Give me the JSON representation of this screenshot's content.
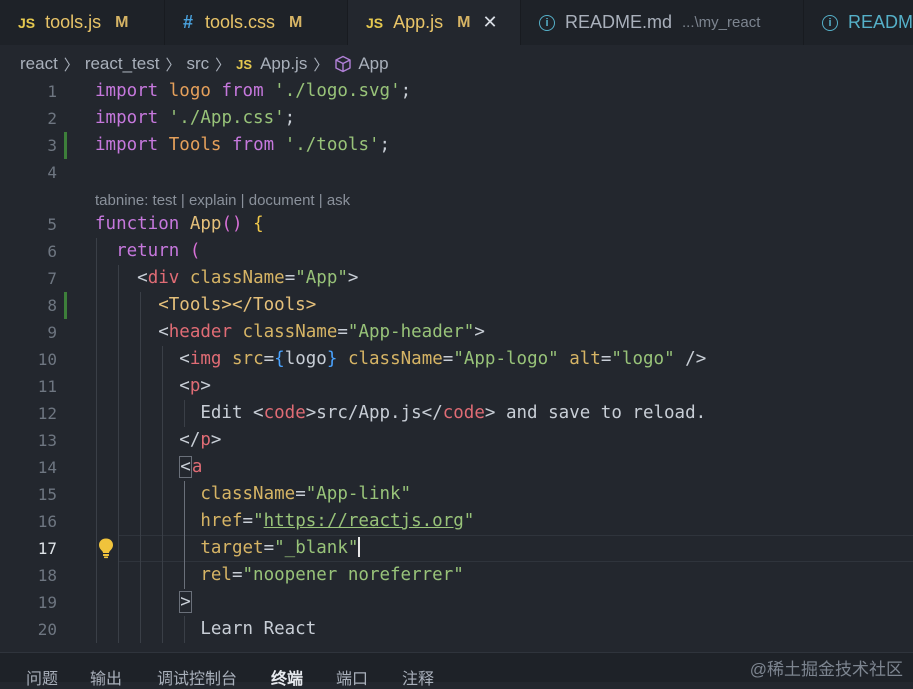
{
  "tabs": [
    {
      "label": "tools.js",
      "icon": "JS",
      "status": "M"
    },
    {
      "label": "tools.css",
      "icon": "#",
      "status": "M"
    },
    {
      "label": "App.js",
      "icon": "JS",
      "status": "M",
      "close": "✕"
    },
    {
      "label": "README.md",
      "icon": "i",
      "description": "...\\my_react"
    },
    {
      "label": "READM",
      "icon": "i"
    }
  ],
  "breadcrumb": [
    "react",
    "react_test",
    "src",
    "App.js",
    "App"
  ],
  "breadcrumb_icon_js": "JS",
  "codelens": "tabnine: test | explain | document | ask",
  "line_numbers": [
    "1",
    "2",
    "3",
    "4",
    "5",
    "6",
    "7",
    "8",
    "9",
    "10",
    "11",
    "12",
    "13",
    "14",
    "15",
    "16",
    "17",
    "18",
    "19",
    "20"
  ],
  "current_line": "17",
  "code": {
    "l1": {
      "kw1": "import",
      "id": "logo",
      "kw2": "from",
      "str": "'./logo.svg'",
      "end": ";"
    },
    "l2": {
      "kw1": "import",
      "str": "'./App.css'",
      "end": ";"
    },
    "l3": {
      "kw1": "import",
      "id": "Tools",
      "kw2": "from",
      "str": "'./tools'",
      "end": ";"
    },
    "l5": {
      "kw": "function",
      "name": "App",
      "paren": "()",
      "brace": "{"
    },
    "l6": {
      "kw": "return",
      "paren": "("
    },
    "l7": {
      "lt": "<",
      "tag": "div",
      "attr": "className",
      "eq": "=",
      "val": "\"App\"",
      "gt": ">"
    },
    "l8": {
      "open": "<Tools></Tools>"
    },
    "l9": {
      "lt": "<",
      "tag": "header",
      "attr": "className",
      "eq": "=",
      "val": "\"App-header\"",
      "gt": ">"
    },
    "l10": {
      "lt": "<",
      "tag": "img",
      "attr1": "src",
      "eq": "=",
      "ob": "{",
      "expr": "logo",
      "cb": "}",
      "attr2": "className",
      "val2": "\"App-logo\"",
      "attr3": "alt",
      "val3": "\"logo\"",
      "end": "/>"
    },
    "l11": {
      "lt": "<",
      "tag": "p",
      "gt": ">"
    },
    "l12": {
      "pre": "Edit ",
      "tag": "code",
      "mid": "src/App.js",
      "post": " and save to reload."
    },
    "l13": {
      "lt": "</",
      "tag": "p",
      "gt": ">"
    },
    "l14": {
      "lt": "<",
      "tag": "a"
    },
    "l15": {
      "attr": "className",
      "eq": "=",
      "val": "\"App-link\""
    },
    "l16": {
      "attr": "href",
      "eq": "=",
      "q1": "\"",
      "url": "https://reactjs.org",
      "q2": "\""
    },
    "l17": {
      "attr": "target",
      "eq": "=",
      "val": "\"_blank\""
    },
    "l18": {
      "attr": "rel",
      "eq": "=",
      "val": "\"noopener noreferrer\""
    },
    "l19": {
      "gt": ">"
    },
    "l20": {
      "text": "Learn React"
    }
  },
  "panel_tabs": [
    "问题",
    "输出",
    "调试控制台",
    "终端",
    "端口",
    "注释"
  ],
  "panel_active": "终端",
  "watermark": "@稀土掘金技术社区",
  "colors": {
    "background": "#23272e",
    "keyword": "#c678dd",
    "string": "#98c379",
    "tag": "#e06c75",
    "attribute": "#d6b465",
    "modified_gutter": "#3d7f3a"
  }
}
